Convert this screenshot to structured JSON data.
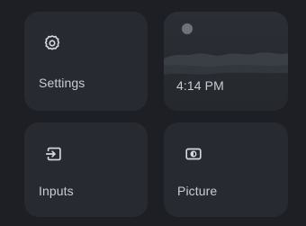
{
  "tiles": {
    "settings": {
      "label": "Settings",
      "icon": "gear-icon"
    },
    "time": {
      "label": "4:14 PM",
      "icon": "ambient-wallpaper"
    },
    "inputs": {
      "label": "Inputs",
      "icon": "input-icon"
    },
    "picture": {
      "label": "Picture",
      "icon": "picture-icon"
    }
  },
  "colors": {
    "background": "#1d1f24",
    "tile": "#272a30",
    "text": "#c9cdd3",
    "icon": "#d6d9de"
  }
}
